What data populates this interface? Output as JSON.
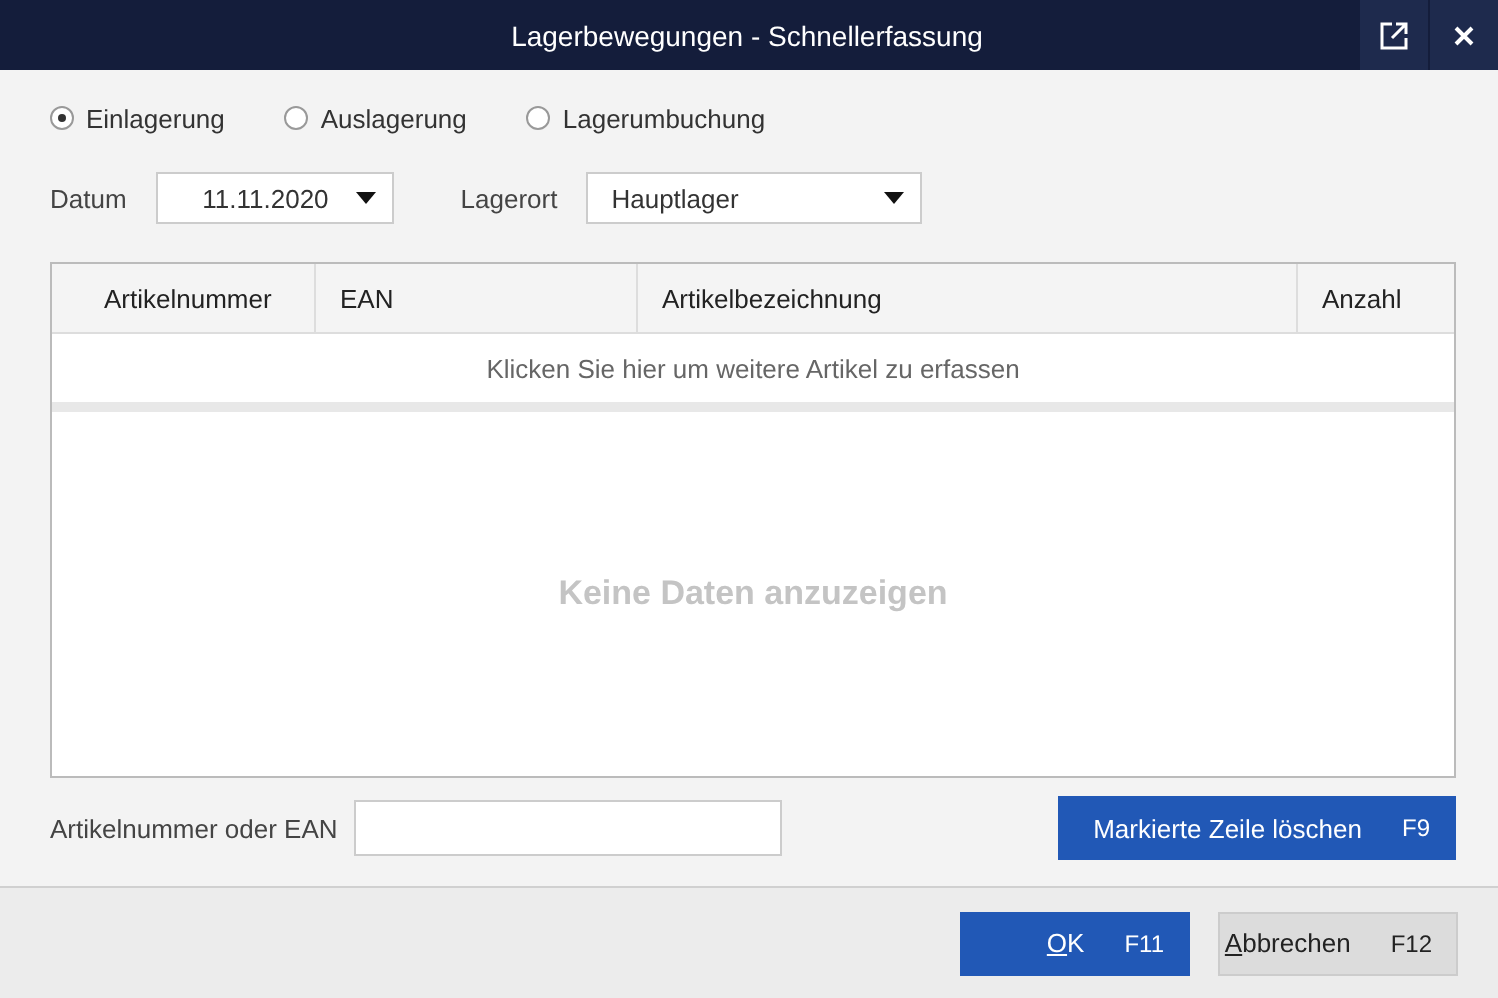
{
  "window": {
    "title": "Lagerbewegungen - Schnellerfassung"
  },
  "movement_types": [
    {
      "label": "Einlagerung",
      "selected": true
    },
    {
      "label": "Auslagerung",
      "selected": false
    },
    {
      "label": "Lagerumbuchung",
      "selected": false
    }
  ],
  "datum": {
    "label": "Datum",
    "value": "11.11.2020"
  },
  "lagerort": {
    "label": "Lagerort",
    "value": "Hauptlager"
  },
  "table": {
    "columns": [
      "Artikelnummer",
      "EAN",
      "Artikelbezeichnung",
      "Anzahl"
    ],
    "add_row": "Klicken Sie hier um weitere Artikel zu erfassen",
    "empty": "Keine Daten anzuzeigen"
  },
  "article_input": {
    "label": "Artikelnummer oder EAN"
  },
  "delete_button": {
    "label": "Markierte Zeile löschen",
    "shortcut": "F9"
  },
  "buttons": [
    {
      "label": "OK",
      "shortcut": "F11",
      "kind": "primary",
      "mnemonic": true
    },
    {
      "label": "Abbrechen",
      "shortcut": "F12",
      "kind": "secondary",
      "mnemonic": true
    }
  ]
}
